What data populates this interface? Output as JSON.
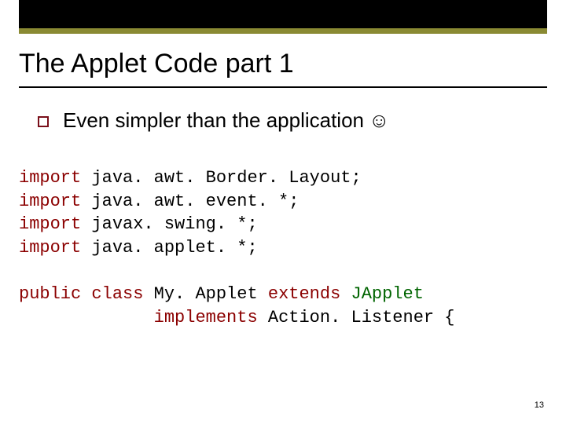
{
  "title": "The Applet Code part 1",
  "bullet": {
    "text": "Even simpler than the application",
    "emoji": "☺"
  },
  "code": {
    "kw_import": "import",
    "line1_rest": " java. awt. Border. Layout;",
    "line2_rest": " java. awt. event. *;",
    "line3_rest": " javax. swing. *;",
    "line4_rest": " java. applet. *;",
    "kw_public": "public",
    "kw_class": "class",
    "cls_pre": " My. Applet ",
    "kw_extends": "extends",
    "cls_name": " JApplet",
    "indent": "             ",
    "kw_implements": "implements",
    "impl_rest": " Action. Listener {"
  },
  "slide_number": "13"
}
